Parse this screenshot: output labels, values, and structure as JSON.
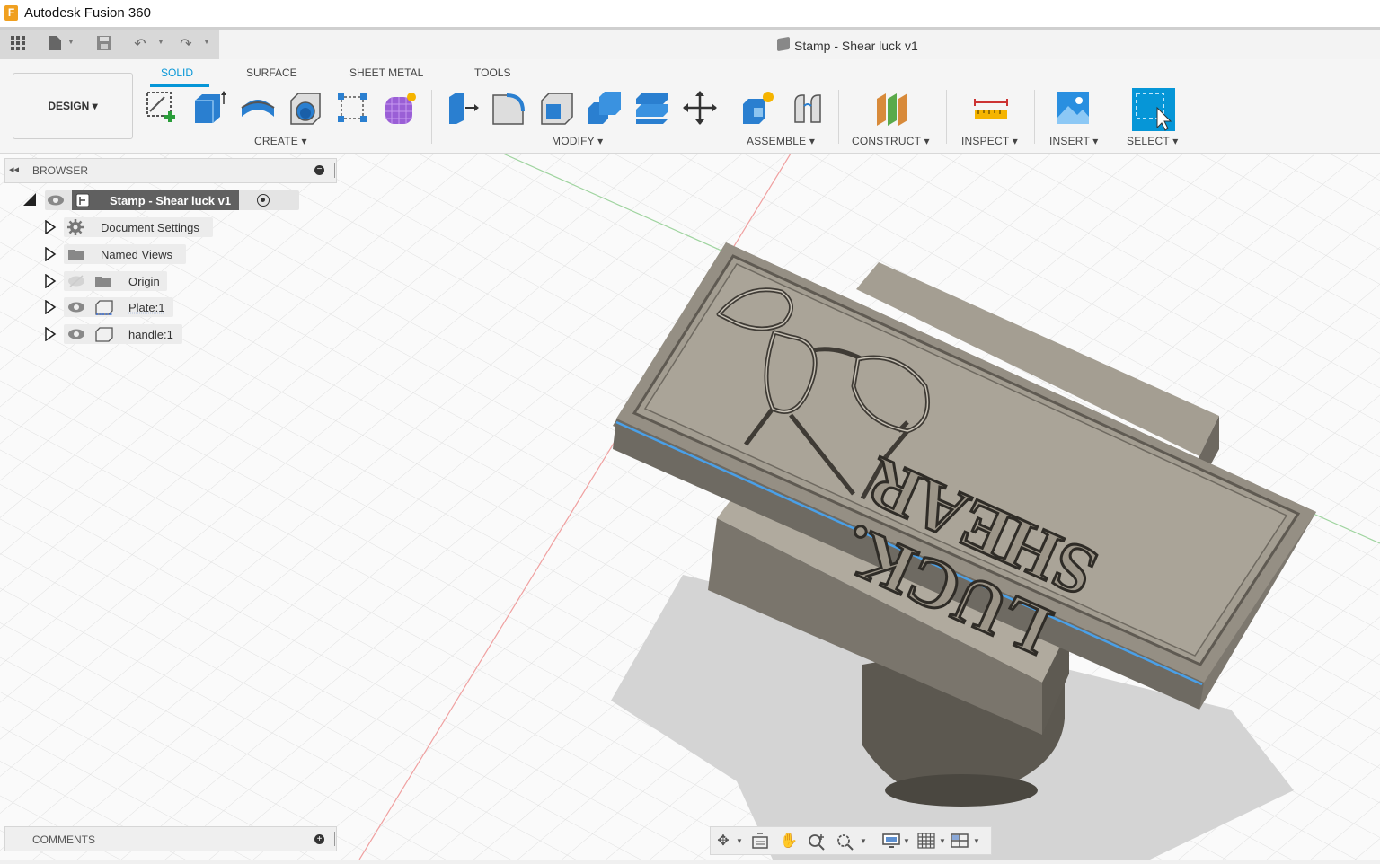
{
  "window": {
    "title": "Autodesk Fusion 360",
    "app_icon_letter": "F"
  },
  "document_tab": {
    "title": "Stamp - Shear luck v1"
  },
  "toolbar": {
    "workspace_label": "DESIGN ▾",
    "tabs": [
      {
        "label": "SOLID",
        "active": true
      },
      {
        "label": "SURFACE",
        "active": false
      },
      {
        "label": "SHEET METAL",
        "active": false
      },
      {
        "label": "TOOLS",
        "active": false
      }
    ],
    "groups": {
      "create": "CREATE ▾",
      "modify": "MODIFY ▾",
      "assemble": "ASSEMBLE ▾",
      "construct": "CONSTRUCT ▾",
      "inspect": "INSPECT ▾",
      "insert": "INSERT ▾",
      "select": "SELECT ▾"
    }
  },
  "browser": {
    "title": "BROWSER",
    "root": "Stamp - Shear luck v1",
    "items": [
      {
        "label": "Document Settings",
        "icon": "gear-icon"
      },
      {
        "label": "Named Views",
        "icon": "folder-icon"
      },
      {
        "label": "Origin",
        "icon": "folder-icon"
      },
      {
        "label": "Plate:1",
        "icon": "body-icon"
      },
      {
        "label": "handle:1",
        "icon": "body-icon"
      }
    ]
  },
  "comments": {
    "title": "COMMENTS"
  },
  "model": {
    "line1": "SHEAR",
    "line2": "LUCK."
  },
  "colors": {
    "accent": "#0696d7",
    "model": "#9c9588",
    "grid": "#e4e4e4"
  }
}
